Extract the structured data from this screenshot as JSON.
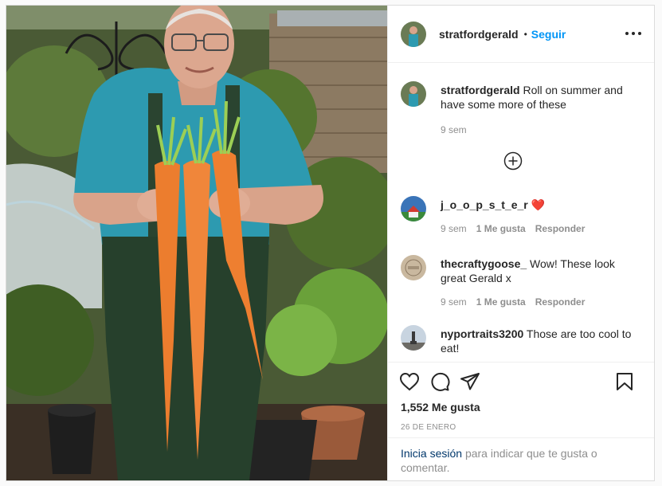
{
  "header": {
    "username": "stratfordgerald",
    "separator": "•",
    "follow_label": "Seguir",
    "more_icon": "more-icon"
  },
  "caption": {
    "username": "stratfordgerald",
    "text": "Roll on summer and have some more of these",
    "time": "9 sem"
  },
  "load_more_icon": "plus-circle-icon",
  "comments": [
    {
      "username": "j_o_o_p_s_t_e_r",
      "text": "❤️",
      "time": "9 sem",
      "likes": "1 Me gusta",
      "reply": "Responder"
    },
    {
      "username": "thecraftygoose_",
      "text": "Wow! These look great Gerald x",
      "time": "9 sem",
      "likes": "1 Me gusta",
      "reply": "Responder"
    },
    {
      "username": "nyportraits3200",
      "text": "Those are too cool to eat!"
    }
  ],
  "actions": {
    "likes": "1,552 Me gusta",
    "date": "26 DE ENERO"
  },
  "login": {
    "link": "Inicia sesión",
    "rest": "para indicar que te gusta o comentar."
  },
  "colors": {
    "accent": "#0095f6",
    "link": "#00376b",
    "muted": "#8e8e8e",
    "heart": "#ed4956"
  }
}
